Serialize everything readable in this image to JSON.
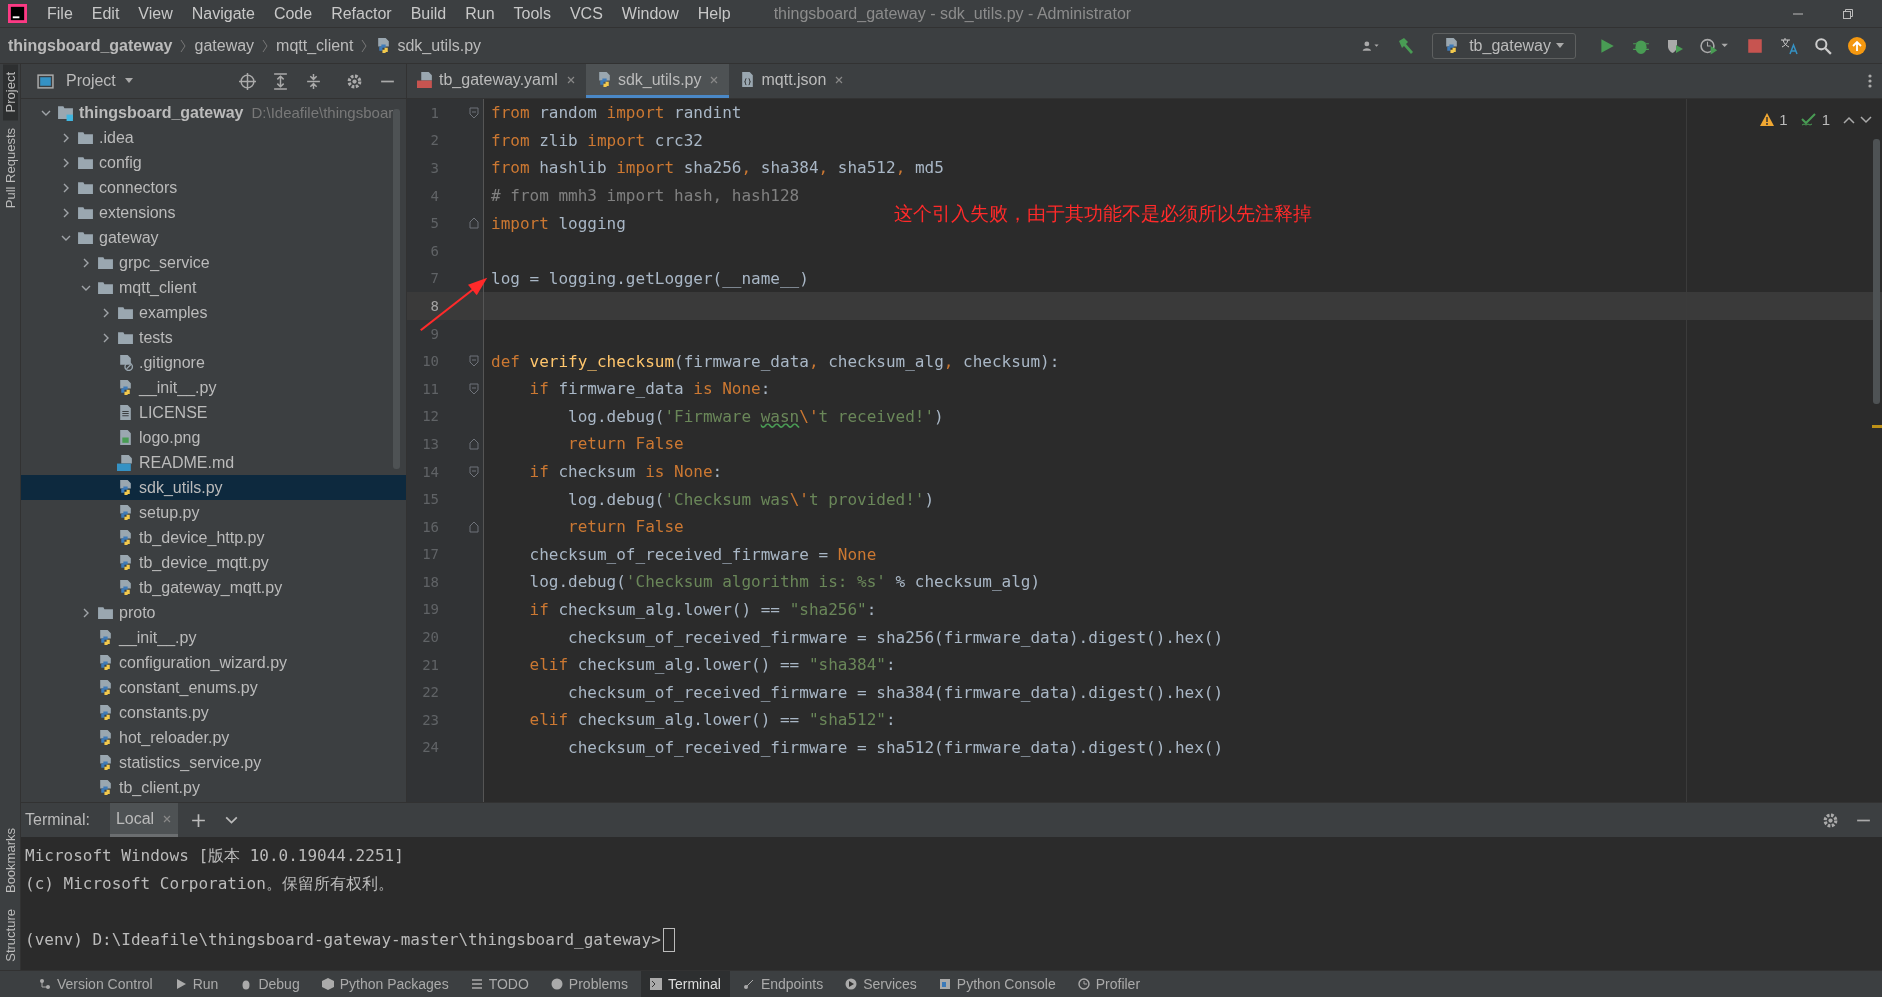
{
  "menu_bar": {
    "items": [
      "File",
      "Edit",
      "View",
      "Navigate",
      "Code",
      "Refactor",
      "Build",
      "Run",
      "Tools",
      "VCS",
      "Window",
      "Help"
    ],
    "title": "thingsboard_gateway - sdk_utils.py - Administrator"
  },
  "breadcrumbs": [
    "thingsboard_gateway",
    "gateway",
    "mqtt_client",
    "sdk_utils.py"
  ],
  "toolbar": {
    "run_configuration": "tb_gateway"
  },
  "side_strip": {
    "top": [
      "Project",
      "Pull Requests"
    ],
    "bottom": [
      "Bookmarks",
      "Structure"
    ]
  },
  "project_panel": {
    "title": "Project",
    "tree": [
      {
        "label": "thingsboard_gateway",
        "path": "D:\\Ideafile\\thingsboar",
        "kind": "module",
        "expanded": true,
        "selected": false,
        "children": [
          {
            "label": ".idea",
            "kind": "folder",
            "expanded": false,
            "selected": false
          },
          {
            "label": "config",
            "kind": "folder",
            "expanded": false,
            "selected": false
          },
          {
            "label": "connectors",
            "kind": "folder",
            "expanded": false,
            "selected": false
          },
          {
            "label": "extensions",
            "kind": "folder",
            "expanded": false,
            "selected": false
          },
          {
            "label": "gateway",
            "kind": "folder",
            "expanded": true,
            "selected": false,
            "children": [
              {
                "label": "grpc_service",
                "kind": "folder",
                "expanded": false,
                "selected": false
              },
              {
                "label": "mqtt_client",
                "kind": "folder",
                "expanded": true,
                "selected": false,
                "children": [
                  {
                    "label": "examples",
                    "kind": "folder",
                    "expanded": false,
                    "selected": false
                  },
                  {
                    "label": "tests",
                    "kind": "folder",
                    "expanded": false,
                    "selected": false
                  },
                  {
                    "label": ".gitignore",
                    "kind": "gitignore",
                    "selected": false
                  },
                  {
                    "label": "__init__.py",
                    "kind": "python",
                    "selected": false
                  },
                  {
                    "label": "LICENSE",
                    "kind": "text",
                    "selected": false
                  },
                  {
                    "label": "logo.png",
                    "kind": "image",
                    "selected": false
                  },
                  {
                    "label": "README.md",
                    "kind": "markdown",
                    "selected": false
                  },
                  {
                    "label": "sdk_utils.py",
                    "kind": "python",
                    "selected": true
                  },
                  {
                    "label": "setup.py",
                    "kind": "python",
                    "selected": false
                  },
                  {
                    "label": "tb_device_http.py",
                    "kind": "python",
                    "selected": false
                  },
                  {
                    "label": "tb_device_mqtt.py",
                    "kind": "python",
                    "selected": false
                  },
                  {
                    "label": "tb_gateway_mqtt.py",
                    "kind": "python",
                    "selected": false
                  }
                ]
              },
              {
                "label": "proto",
                "kind": "folder",
                "expanded": false,
                "selected": false
              },
              {
                "label": "__init__.py",
                "kind": "python",
                "selected": false
              },
              {
                "label": "configuration_wizard.py",
                "kind": "python",
                "selected": false
              },
              {
                "label": "constant_enums.py",
                "kind": "python",
                "selected": false
              },
              {
                "label": "constants.py",
                "kind": "python",
                "selected": false
              },
              {
                "label": "hot_reloader.py",
                "kind": "python",
                "selected": false
              },
              {
                "label": "statistics_service.py",
                "kind": "python",
                "selected": false
              },
              {
                "label": "tb_client.py",
                "kind": "python",
                "selected": false
              }
            ]
          }
        ]
      }
    ]
  },
  "editor": {
    "tabs": [
      {
        "label": "tb_gateway.yaml",
        "kind": "yaml",
        "selected": false
      },
      {
        "label": "sdk_utils.py",
        "kind": "python",
        "selected": true
      },
      {
        "label": "mqtt.json",
        "kind": "json",
        "selected": false
      }
    ],
    "inspections": {
      "warnings": "1",
      "typos": "1"
    },
    "lines": [
      {
        "number": "1",
        "fold_start": true,
        "fold_end": false,
        "current": false,
        "tokens": [
          {
            "kind": "kw",
            "text": "from"
          },
          {
            "kind": "t",
            "text": " random "
          },
          {
            "kind": "kw",
            "text": "import"
          },
          {
            "kind": "t",
            "text": " randint"
          }
        ]
      },
      {
        "number": "2",
        "fold_start": false,
        "fold_end": false,
        "current": false,
        "tokens": [
          {
            "kind": "kw",
            "text": "from"
          },
          {
            "kind": "t",
            "text": " zlib "
          },
          {
            "kind": "kw",
            "text": "import"
          },
          {
            "kind": "t",
            "text": " crc32"
          }
        ]
      },
      {
        "number": "3",
        "fold_start": false,
        "fold_end": false,
        "current": false,
        "tokens": [
          {
            "kind": "kw",
            "text": "from"
          },
          {
            "kind": "t",
            "text": " hashlib "
          },
          {
            "kind": "kw",
            "text": "import"
          },
          {
            "kind": "t",
            "text": " sha256"
          },
          {
            "kind": "kw",
            "text": ","
          },
          {
            "kind": "t",
            "text": " sha384"
          },
          {
            "kind": "kw",
            "text": ","
          },
          {
            "kind": "t",
            "text": " sha512"
          },
          {
            "kind": "kw",
            "text": ","
          },
          {
            "kind": "t",
            "text": " md5"
          }
        ]
      },
      {
        "number": "4",
        "fold_start": false,
        "fold_end": false,
        "current": false,
        "tokens": [
          {
            "kind": "c",
            "text": "# from mmh3 import hash, hash128"
          }
        ]
      },
      {
        "number": "5",
        "fold_start": false,
        "fold_end": true,
        "current": false,
        "tokens": [
          {
            "kind": "kw",
            "text": "import"
          },
          {
            "kind": "t",
            "text": " logging"
          }
        ]
      },
      {
        "number": "6",
        "fold_start": false,
        "fold_end": false,
        "current": false
      },
      {
        "number": "7",
        "fold_start": false,
        "fold_end": false,
        "current": false,
        "tokens": [
          {
            "kind": "t",
            "text": "log = logging.getLogger(__name__)"
          }
        ]
      },
      {
        "number": "8",
        "fold_start": false,
        "fold_end": false,
        "current": true
      },
      {
        "number": "9",
        "fold_start": false,
        "fold_end": false,
        "current": false
      },
      {
        "number": "10",
        "fold_start": true,
        "fold_end": false,
        "current": false,
        "tokens": [
          {
            "kind": "kw",
            "text": "def "
          },
          {
            "kind": "f",
            "text": "verify_checksum"
          },
          {
            "kind": "t",
            "text": "(firmware_data"
          },
          {
            "kind": "kw",
            "text": ","
          },
          {
            "kind": "t",
            "text": " checksum_alg"
          },
          {
            "kind": "kw",
            "text": ","
          },
          {
            "kind": "t",
            "text": " checksum):"
          }
        ]
      },
      {
        "number": "11",
        "fold_start": true,
        "fold_end": false,
        "current": false,
        "tokens": [
          {
            "kind": "kw",
            "text": "    if"
          },
          {
            "kind": "t",
            "text": " firmware_data "
          },
          {
            "kind": "kw",
            "text": "is None"
          },
          {
            "kind": "t",
            "text": ":"
          }
        ]
      },
      {
        "number": "12",
        "fold_start": false,
        "fold_end": false,
        "current": false,
        "tokens": [
          {
            "kind": "t",
            "text": "        log.debug("
          },
          {
            "kind": "s",
            "text": "'Firmware "
          },
          {
            "kind": "typo",
            "text": "wasn"
          },
          {
            "kind": "kw",
            "text": "\\'"
          },
          {
            "kind": "s",
            "text": "t received!'"
          },
          {
            "kind": "t",
            "text": ")"
          }
        ]
      },
      {
        "number": "13",
        "fold_start": false,
        "fold_end": true,
        "current": false,
        "tokens": [
          {
            "kind": "kw",
            "text": "        return False"
          }
        ]
      },
      {
        "number": "14",
        "fold_start": true,
        "fold_end": false,
        "current": false,
        "tokens": [
          {
            "kind": "kw",
            "text": "    if"
          },
          {
            "kind": "t",
            "text": " checksum "
          },
          {
            "kind": "kw",
            "text": "is None"
          },
          {
            "kind": "t",
            "text": ":"
          }
        ]
      },
      {
        "number": "15",
        "fold_start": false,
        "fold_end": false,
        "current": false,
        "tokens": [
          {
            "kind": "t",
            "text": "        log.debug("
          },
          {
            "kind": "s",
            "text": "'Checksum was"
          },
          {
            "kind": "kw",
            "text": "\\'"
          },
          {
            "kind": "s",
            "text": "t provided!'"
          },
          {
            "kind": "t",
            "text": ")"
          }
        ]
      },
      {
        "number": "16",
        "fold_start": false,
        "fold_end": true,
        "current": false,
        "tokens": [
          {
            "kind": "kw",
            "text": "        return False"
          }
        ]
      },
      {
        "number": "17",
        "fold_start": false,
        "fold_end": false,
        "current": false,
        "tokens": [
          {
            "kind": "t",
            "text": "    checksum_of_received_firmware = "
          },
          {
            "kind": "kw",
            "text": "None"
          }
        ]
      },
      {
        "number": "18",
        "fold_start": false,
        "fold_end": false,
        "current": false,
        "tokens": [
          {
            "kind": "t",
            "text": "    log.debug("
          },
          {
            "kind": "s",
            "text": "'Checksum algorithm is: %s'"
          },
          {
            "kind": "t",
            "text": " % checksum_alg)"
          }
        ]
      },
      {
        "number": "19",
        "fold_start": false,
        "fold_end": false,
        "current": false,
        "tokens": [
          {
            "kind": "kw",
            "text": "    if"
          },
          {
            "kind": "t",
            "text": " checksum_alg.lower() == "
          },
          {
            "kind": "s",
            "text": "\"sha256\""
          },
          {
            "kind": "t",
            "text": ":"
          }
        ]
      },
      {
        "number": "20",
        "fold_start": false,
        "fold_end": false,
        "current": false,
        "tokens": [
          {
            "kind": "t",
            "text": "        checksum_of_received_firmware = sha256(firmware_data).digest().hex()"
          }
        ]
      },
      {
        "number": "21",
        "fold_start": false,
        "fold_end": false,
        "current": false,
        "tokens": [
          {
            "kind": "kw",
            "text": "    elif"
          },
          {
            "kind": "t",
            "text": " checksum_alg.lower() == "
          },
          {
            "kind": "s",
            "text": "\"sha384\""
          },
          {
            "kind": "t",
            "text": ":"
          }
        ]
      },
      {
        "number": "22",
        "fold_start": false,
        "fold_end": false,
        "current": false,
        "tokens": [
          {
            "kind": "t",
            "text": "        checksum_of_received_firmware = sha384(firmware_data).digest().hex()"
          }
        ]
      },
      {
        "number": "23",
        "fold_start": false,
        "fold_end": false,
        "current": false,
        "tokens": [
          {
            "kind": "kw",
            "text": "    elif"
          },
          {
            "kind": "t",
            "text": " checksum_alg.lower() == "
          },
          {
            "kind": "s",
            "text": "\"sha512\""
          },
          {
            "kind": "t",
            "text": ":"
          }
        ]
      },
      {
        "number": "24",
        "fold_start": false,
        "fold_end": false,
        "current": false,
        "tokens": [
          {
            "kind": "t",
            "text": "        checksum_of_received_firmware = sha512(firmware_data).digest().hex()"
          }
        ]
      }
    ]
  },
  "annotation": {
    "text": "这个引入失败，由于其功能不是必须所以先注释掉"
  },
  "terminal": {
    "label": "Terminal:",
    "tabs": [
      {
        "label": "Local",
        "selected": true
      }
    ],
    "lines": [
      "Microsoft Windows [版本 10.0.19044.2251]",
      "(c) Microsoft Corporation。保留所有权利。",
      "(venv) D:\\Ideafile\\thingsboard-gateway-master\\thingsboard_gateway>"
    ]
  },
  "bottom_bar": [
    {
      "label": "Version Control",
      "kind": "vcs",
      "selected": false
    },
    {
      "label": "Run",
      "kind": "run",
      "selected": false
    },
    {
      "label": "Debug",
      "kind": "debug",
      "selected": false
    },
    {
      "label": "Python Packages",
      "kind": "packages",
      "selected": false
    },
    {
      "label": "TODO",
      "kind": "todo",
      "selected": false
    },
    {
      "label": "Problems",
      "kind": "problems",
      "selected": false
    },
    {
      "label": "Terminal",
      "kind": "terminal",
      "selected": true
    },
    {
      "label": "Endpoints",
      "kind": "endpoints",
      "selected": false
    },
    {
      "label": "Services",
      "kind": "services",
      "selected": false
    },
    {
      "label": "Python Console",
      "kind": "console",
      "selected": false
    },
    {
      "label": "Profiler",
      "kind": "profiler",
      "selected": false
    }
  ]
}
